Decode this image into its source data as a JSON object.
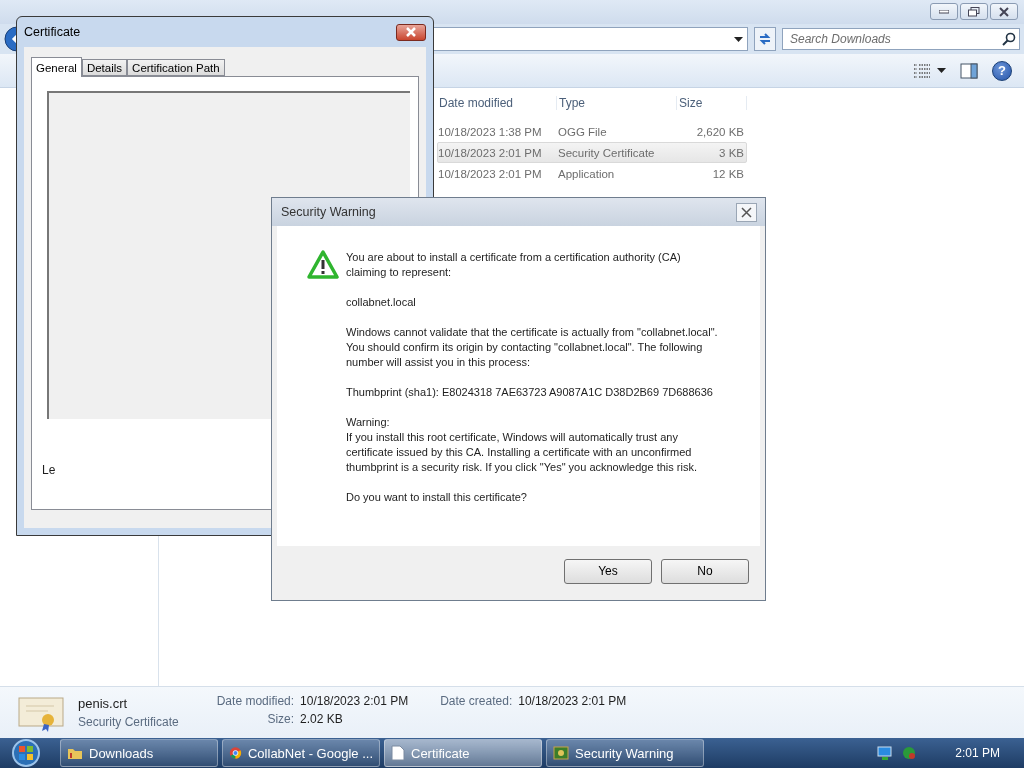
{
  "explorer": {
    "search": {
      "placeholder": "Search Downloads"
    },
    "columns": [
      "Date modified",
      "Type",
      "Size"
    ],
    "rows": [
      {
        "date": "10/18/2023 1:38 PM",
        "type": "OGG File",
        "size": "2,620 KB",
        "selected": false
      },
      {
        "date": "10/18/2023 2:01 PM",
        "type": "Security Certificate",
        "size": "3 KB",
        "selected": true
      },
      {
        "date": "10/18/2023 2:01 PM",
        "type": "Application",
        "size": "12 KB",
        "selected": false
      }
    ],
    "help_glyph": "?",
    "details": {
      "name": "penis.crt",
      "type": "Security Certificate",
      "fields": [
        {
          "label": "Date modified:",
          "value": "10/18/2023 2:01 PM"
        },
        {
          "label": "Size:",
          "value": "2.02 KB"
        },
        {
          "label": "Date created:",
          "value": "10/18/2023 2:01 PM"
        }
      ]
    }
  },
  "certificate_window": {
    "title": "Certificate",
    "tabs": [
      {
        "label": "General",
        "selected": true
      },
      {
        "label": "Details",
        "selected": false
      },
      {
        "label": "Certification Path",
        "selected": false
      }
    ],
    "partial_text": "Le"
  },
  "security_warning": {
    "title": "Security Warning",
    "paragraphs": [
      "You are about to install a certificate from a certification authority (CA) claiming to represent:",
      "collabnet.local",
      "Windows cannot validate that the certificate is actually from \"collabnet.local\". You should confirm its origin by contacting \"collabnet.local\". The following number will assist you in this process:",
      "Thumbprint (sha1): E8024318 7AE63723 A9087A1C D38D2B69 7D688636",
      "Warning:",
      "If you install this root certificate, Windows will automatically trust any certificate issued by this CA. Installing a certificate with an unconfirmed thumbprint is a security risk. If you click \"Yes\" you acknowledge this risk.",
      "Do you want to install this certificate?"
    ],
    "buttons": [
      "Yes",
      "No"
    ]
  },
  "taskbar": {
    "items": [
      {
        "label": "Downloads",
        "kind": "folder",
        "selected": false
      },
      {
        "label": "CollabNet - Google ...",
        "kind": "browser",
        "selected": false
      },
      {
        "label": "Certificate",
        "kind": "document",
        "selected": true
      },
      {
        "label": "Security Warning",
        "kind": "shield",
        "selected": false
      }
    ],
    "clock": "2:01 PM"
  }
}
